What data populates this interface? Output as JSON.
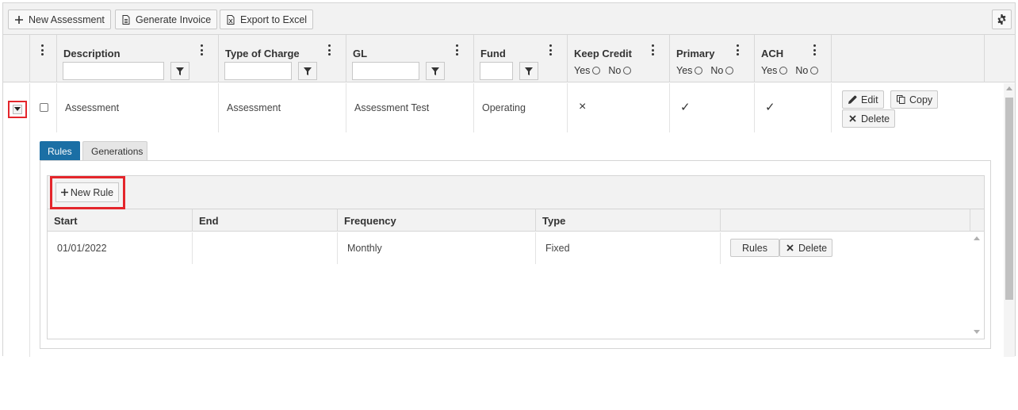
{
  "toolbar": {
    "new_assessment": "New Assessment",
    "generate_invoice": "Generate Invoice",
    "export_excel": "Export to Excel"
  },
  "columns": {
    "description": "Description",
    "type_of_charge": "Type of Charge",
    "gl": "GL",
    "fund": "Fund",
    "keep_credit": "Keep Credit",
    "primary": "Primary",
    "ach": "ACH"
  },
  "radio": {
    "yes": "Yes",
    "no": "No"
  },
  "row": {
    "description": "Assessment",
    "type_of_charge": "Assessment",
    "gl": "Assessment Test",
    "fund": "Operating",
    "keep_credit": "×",
    "primary": "✓",
    "ach": "✓"
  },
  "row_actions": {
    "edit": "Edit",
    "copy": "Copy",
    "delete": "Delete"
  },
  "tabs": {
    "rules": "Rules",
    "generations": "Generations"
  },
  "rules": {
    "new_rule": "New Rule",
    "headers": {
      "start": "Start",
      "end": "End",
      "frequency": "Frequency",
      "type": "Type"
    },
    "row": {
      "start": "01/01/2022",
      "end": "",
      "frequency": "Monthly",
      "type": "Fixed"
    },
    "actions": {
      "rules": "Rules",
      "delete": "Delete"
    }
  },
  "colors": {
    "tab_active": "#1b6fa5",
    "highlight": "#e4252b"
  }
}
